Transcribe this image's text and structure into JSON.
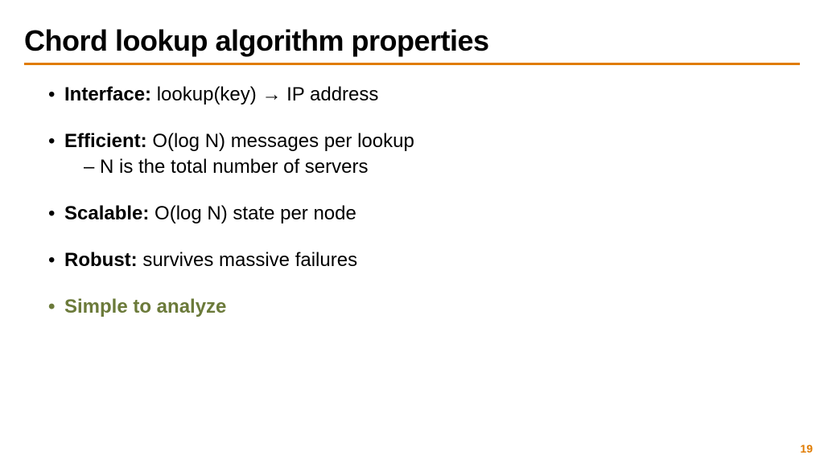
{
  "title": "Chord lookup algorithm properties",
  "bullets": {
    "b1_label": "Interface:",
    "b1_text": " lookup(key) → IP address",
    "b2_label": "Efficient:",
    "b2_text": " O(log N) messages per lookup",
    "b2_sub": "N is the total number of servers",
    "b3_label": "Scalable:",
    "b3_text": " O(log N) state per node",
    "b4_label": "Robust:",
    "b4_text": " survives massive failures",
    "b5_text": "Simple to analyze"
  },
  "page_number": "19"
}
